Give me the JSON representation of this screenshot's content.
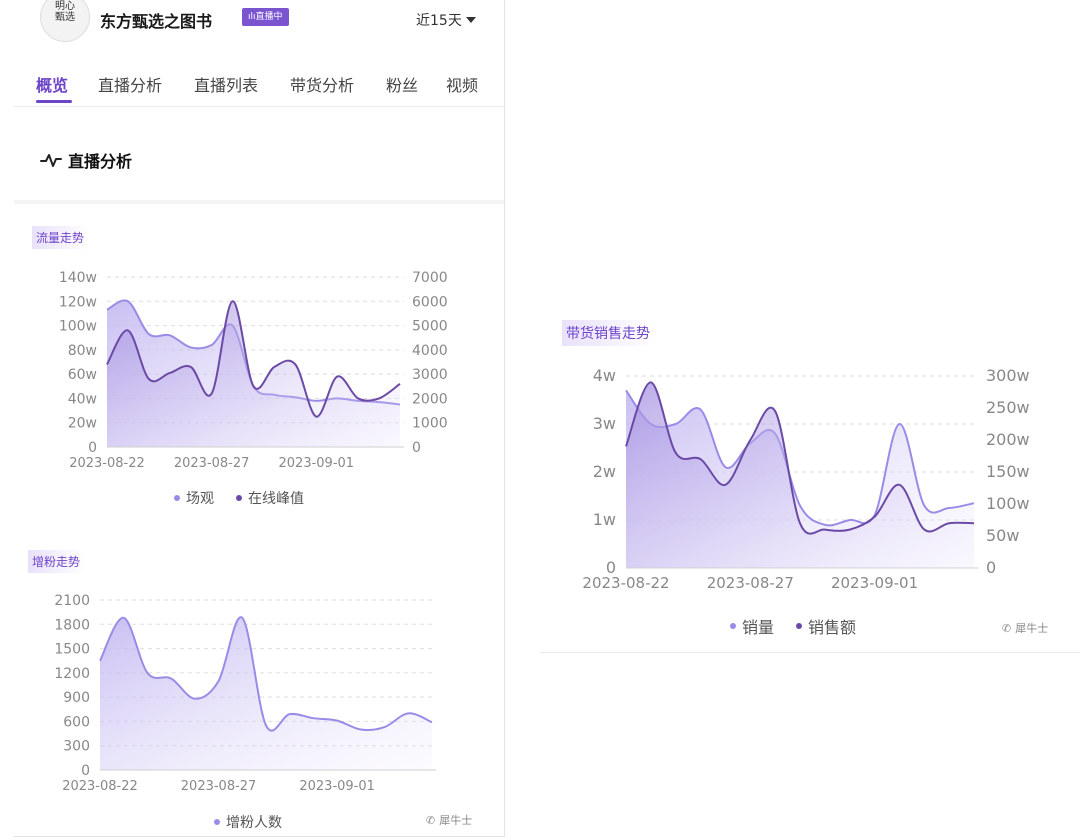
{
  "header": {
    "account_name": "东方甄选之图书",
    "live_badge": "ılı直播中",
    "date_filter": "近15天",
    "avatar_text": "明心\n甄选"
  },
  "tabs": [
    {
      "label": "概览",
      "active": true
    },
    {
      "label": "直播分析",
      "active": false
    },
    {
      "label": "直播列表",
      "active": false
    },
    {
      "label": "带货分析",
      "active": false
    },
    {
      "label": "粉丝",
      "active": false
    },
    {
      "label": "视频",
      "active": false
    }
  ],
  "section": {
    "title": "直播分析"
  },
  "watermark": "犀牛士",
  "colors": {
    "accent": "#6d45c8",
    "series_light": "#9a8be6",
    "series_dark": "#6b4aa6"
  },
  "chart_data": [
    {
      "type": "area",
      "title": "流量走势",
      "x_ticks": [
        "2023-08-22",
        "2023-08-27",
        "2023-09-01"
      ],
      "x": [
        "2023-08-22",
        "2023-08-23",
        "2023-08-24",
        "2023-08-25",
        "2023-08-26",
        "2023-08-27",
        "2023-08-28",
        "2023-08-29",
        "2023-08-30",
        "2023-08-31",
        "2023-09-01",
        "2023-09-02",
        "2023-09-03",
        "2023-09-04",
        "2023-09-05"
      ],
      "ylim": [
        0,
        140
      ],
      "y_ticks": [
        "0",
        "20w",
        "40w",
        "60w",
        "80w",
        "100w",
        "120w",
        "140w"
      ],
      "y2lim": [
        0,
        7000
      ],
      "y2_ticks": [
        "0",
        "1000",
        "2000",
        "3000",
        "4000",
        "5000",
        "6000",
        "7000"
      ],
      "series": [
        {
          "name": "场观",
          "axis": "left",
          "unit": "w",
          "values": [
            113,
            120,
            93,
            92,
            82,
            84,
            100,
            50,
            43,
            41,
            38,
            40,
            38,
            37,
            35
          ]
        },
        {
          "name": "在线峰值",
          "axis": "right",
          "values": [
            3400,
            4800,
            2800,
            3050,
            3300,
            2200,
            6000,
            2500,
            3300,
            3400,
            1250,
            2900,
            2000,
            2000,
            2600
          ]
        }
      ],
      "legend": "bottom"
    },
    {
      "type": "area",
      "title": "增粉走势",
      "x_ticks": [
        "2023-08-22",
        "2023-08-27",
        "2023-09-01"
      ],
      "x": [
        "2023-08-22",
        "2023-08-23",
        "2023-08-24",
        "2023-08-25",
        "2023-08-26",
        "2023-08-27",
        "2023-08-28",
        "2023-08-29",
        "2023-08-30",
        "2023-08-31",
        "2023-09-01",
        "2023-09-02",
        "2023-09-03",
        "2023-09-04",
        "2023-09-05"
      ],
      "ylim": [
        0,
        2100
      ],
      "y_ticks": [
        "0",
        "300",
        "600",
        "900",
        "1200",
        "1500",
        "1800",
        "2100"
      ],
      "series": [
        {
          "name": "增粉人数",
          "values": [
            1350,
            1880,
            1200,
            1130,
            880,
            1100,
            1880,
            550,
            690,
            640,
            610,
            500,
            530,
            700,
            590
          ]
        }
      ],
      "legend": "bottom"
    },
    {
      "type": "area",
      "title": "带货销售走势",
      "x_ticks": [
        "2023-08-22",
        "2023-08-27",
        "2023-09-01"
      ],
      "x": [
        "2023-08-22",
        "2023-08-23",
        "2023-08-24",
        "2023-08-25",
        "2023-08-26",
        "2023-08-27",
        "2023-08-28",
        "2023-08-29",
        "2023-08-30",
        "2023-08-31",
        "2023-09-01",
        "2023-09-02",
        "2023-09-03",
        "2023-09-04",
        "2023-09-05"
      ],
      "ylim": [
        0,
        4
      ],
      "y_ticks": [
        "0",
        "1w",
        "2w",
        "3w",
        "4w"
      ],
      "y2lim": [
        0,
        300
      ],
      "y2_ticks": [
        "0",
        "50w",
        "100w",
        "150w",
        "200w",
        "250w",
        "300w"
      ],
      "series": [
        {
          "name": "销量",
          "axis": "left",
          "unit": "w",
          "values": [
            3.7,
            3.0,
            3.0,
            3.3,
            2.1,
            2.6,
            2.8,
            1.3,
            0.9,
            1.0,
            1.1,
            3.0,
            1.3,
            1.25,
            1.35
          ]
        },
        {
          "name": "销售额",
          "axis": "right",
          "unit": "w",
          "values": [
            190,
            290,
            180,
            170,
            130,
            200,
            245,
            70,
            60,
            60,
            80,
            130,
            60,
            70,
            70
          ]
        }
      ],
      "legend": "bottom"
    }
  ]
}
